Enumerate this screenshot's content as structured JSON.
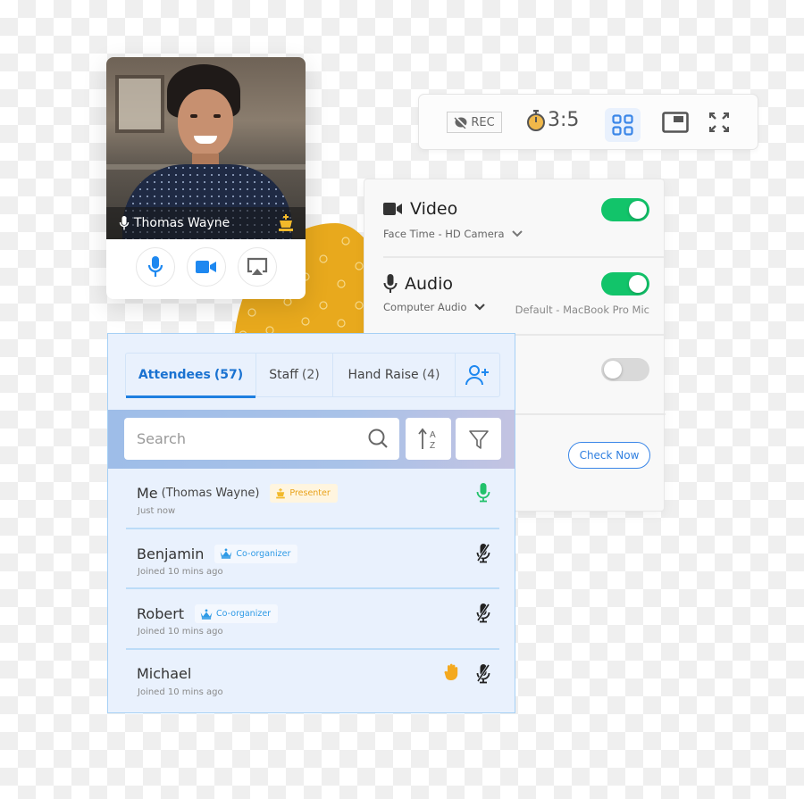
{
  "video_card": {
    "participant_name": "Thomas Wayne",
    "controls": [
      "mic-icon",
      "video-camera-icon",
      "screen-share-icon"
    ]
  },
  "toolbar": {
    "rec_label": "REC",
    "timer": "3:5",
    "buttons": [
      "grid-view-icon",
      "picture-in-picture-icon",
      "fullscreen-icon"
    ],
    "accent_color": "#3a86e8",
    "timer_color": "#f0b84a"
  },
  "settings": {
    "video": {
      "title": "Video",
      "device": "Face Time - HD Camera",
      "enabled": true
    },
    "audio": {
      "title": "Audio",
      "device": "Computer Audio",
      "mic": "Default - MacBook Pro Mic",
      "enabled": true
    },
    "third": {
      "enabled": false
    },
    "check_button": "Check Now",
    "toggle_on_color": "#12c46a"
  },
  "attendees_panel": {
    "tabs": [
      {
        "label": "Attendees",
        "count": "(57)",
        "active": true
      },
      {
        "label": "Staff",
        "count": "(2)",
        "active": false
      },
      {
        "label": "Hand Raise",
        "count": "(4)",
        "active": false
      }
    ],
    "search_placeholder": "Search",
    "list": [
      {
        "name": "Me",
        "paren": "(Thomas Wayne)",
        "badge": "Presenter",
        "sub": "Just now",
        "mic": "on",
        "hand": false
      },
      {
        "name": "Benjamin",
        "paren": "",
        "badge": "Co-organizer",
        "sub": "Joined 10 mins ago",
        "mic": "muted",
        "hand": false
      },
      {
        "name": "Robert",
        "paren": "",
        "badge": "Co-organizer",
        "sub": "Joined 10 mins ago",
        "mic": "muted",
        "hand": false
      },
      {
        "name": "Michael",
        "paren": "",
        "badge": "",
        "sub": "Joined 10 mins ago",
        "mic": "muted",
        "hand": true
      }
    ]
  }
}
